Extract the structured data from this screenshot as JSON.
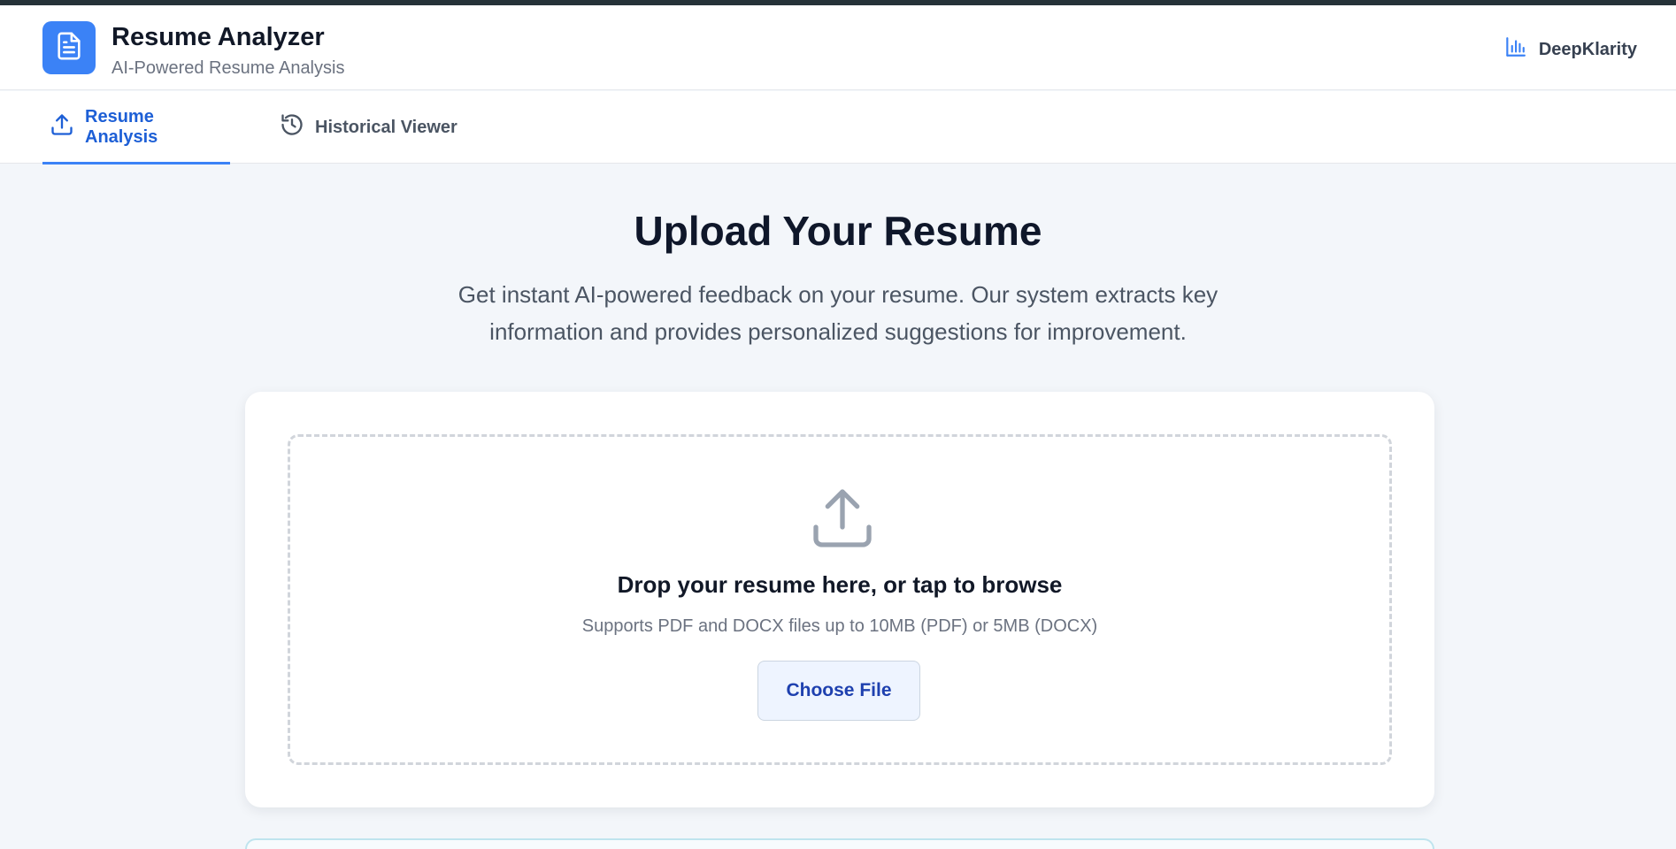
{
  "header": {
    "title": "Resume Analyzer",
    "subtitle": "AI-Powered Resume Analysis",
    "brand_label": "DeepKlarity",
    "logo_icon": "document-icon",
    "brand_icon": "bar-chart-icon"
  },
  "tabs": [
    {
      "label": "Resume Analysis",
      "icon": "upload-icon",
      "active": true
    },
    {
      "label": "Historical Viewer",
      "icon": "history-icon",
      "active": false
    }
  ],
  "main": {
    "title": "Upload Your Resume",
    "description": "Get instant AI-powered feedback on your resume. Our system extracts key information and provides personalized suggestions for improvement."
  },
  "upload": {
    "prompt": "Drop your resume here, or tap to browse",
    "hint": "Supports PDF and DOCX files up to 10MB (PDF) or 5MB (DOCX)",
    "button_label": "Choose File",
    "icon": "upload-icon"
  },
  "colors": {
    "accent": "#3b82f6",
    "active_tab_text": "#1d5fd6",
    "page_background": "#f3f6fa"
  }
}
